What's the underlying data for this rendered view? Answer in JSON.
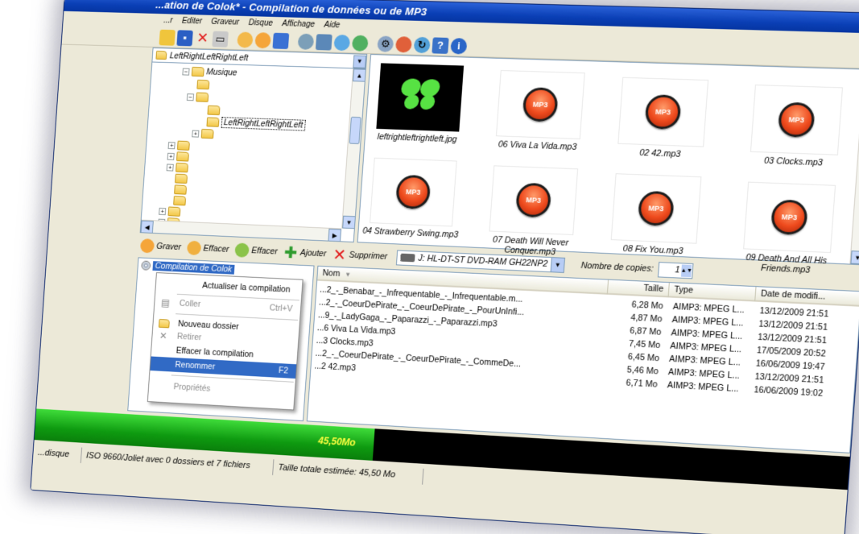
{
  "window": {
    "title": "...ation de Colok* - Compilation de données ou de MP3"
  },
  "menu": [
    "...r",
    "Editer",
    "Graveur",
    "Disque",
    "Affichage",
    "Aide"
  ],
  "tree": {
    "path": "LeftRightLeftRightLeft",
    "nodes": [
      {
        "label": "Musique"
      },
      {
        "label": ""
      },
      {
        "label": ""
      },
      {
        "label": "LeftRightLeftRightLeft"
      }
    ]
  },
  "icons": [
    {
      "label": "leftrightleftrightleft.jpg",
      "kind": "image"
    },
    {
      "label": "06 Viva La Vida.mp3",
      "kind": "mp3"
    },
    {
      "label": "02 42.mp3",
      "kind": "mp3"
    },
    {
      "label": "03 Clocks.mp3",
      "kind": "mp3"
    },
    {
      "label": "04 Strawberry Swing.mp3",
      "kind": "mp3"
    },
    {
      "label": "07 Death Will Never Conquer.mp3",
      "kind": "mp3"
    },
    {
      "label": "08 Fix You.mp3",
      "kind": "mp3"
    },
    {
      "label": "09 Death And All His Friends.mp3",
      "kind": "mp3"
    }
  ],
  "mp3_badge": "MP3",
  "actions": {
    "graver": "Graver",
    "effacer": "Effacer",
    "effacer2": "Effacer",
    "ajouter": "Ajouter",
    "supprimer": "Supprimer",
    "drive": "J: HL-DT-ST DVD-RAM GH22NP2",
    "copies_label": "Nombre de copies:",
    "copies_value": "1"
  },
  "compilation": {
    "label": "Compilation de Colok"
  },
  "columns": {
    "name": "Nom",
    "size": "Taille",
    "type": "Type",
    "date": "Date de modifi..."
  },
  "files": [
    {
      "name": "...2_-_Benabar_-_Infrequentable_-_Infrequentable.m...",
      "size": "6,28 Mo",
      "type": "AIMP3: MPEG L...",
      "date": "13/12/2009 21:51"
    },
    {
      "name": "...2_-_CoeurDePirate_-_CoeurDePirate_-_PourUnInfi...",
      "size": "4,87 Mo",
      "type": "AIMP3: MPEG L...",
      "date": "13/12/2009 21:51"
    },
    {
      "name": "...9_-_LadyGaga_-_Paparazzi_-_Paparazzi.mp3",
      "size": "6,87 Mo",
      "type": "AIMP3: MPEG L...",
      "date": "13/12/2009 21:51"
    },
    {
      "name": "...6 Viva La Vida.mp3",
      "size": "7,45 Mo",
      "type": "AIMP3: MPEG L...",
      "date": "17/05/2009 20:52"
    },
    {
      "name": "...3 Clocks.mp3",
      "size": "6,45 Mo",
      "type": "AIMP3: MPEG L...",
      "date": "16/06/2009 19:47"
    },
    {
      "name": "...2_-_CoeurDePirate_-_CoeurDePirate_-_CommeDe...",
      "size": "5,46 Mo",
      "type": "AIMP3: MPEG L...",
      "date": "13/12/2009 21:51"
    },
    {
      "name": "...2 42.mp3",
      "size": "6,71 Mo",
      "type": "AIMP3: MPEG L...",
      "date": "16/06/2009 19:02"
    }
  ],
  "context_menu": {
    "items": [
      {
        "label": "Actualiser la compilation"
      },
      {
        "label": "Coller",
        "shortcut": "Ctrl+V"
      },
      {
        "label": "Nouveau dossier"
      },
      {
        "label": "Retirer"
      },
      {
        "label": "Effacer la compilation"
      },
      {
        "label": "Renommer",
        "shortcut": "F2"
      },
      {
        "label": "Propriétés"
      }
    ]
  },
  "progress": {
    "text": "45,50Mo",
    "fraction": 0.43
  },
  "status": {
    "disc": "...disque",
    "fs": "ISO 9660/Joliet avec 0 dossiers et 7 fichiers",
    "total": "Taille totale estimée: 45,50 Mo"
  },
  "colors": {
    "titlebar": "#0a3fb5",
    "selection": "#316ac5",
    "progress_green": "#0e9a10",
    "progress_text": "#ffff40",
    "mp3_orange": "#ee4a1d"
  }
}
